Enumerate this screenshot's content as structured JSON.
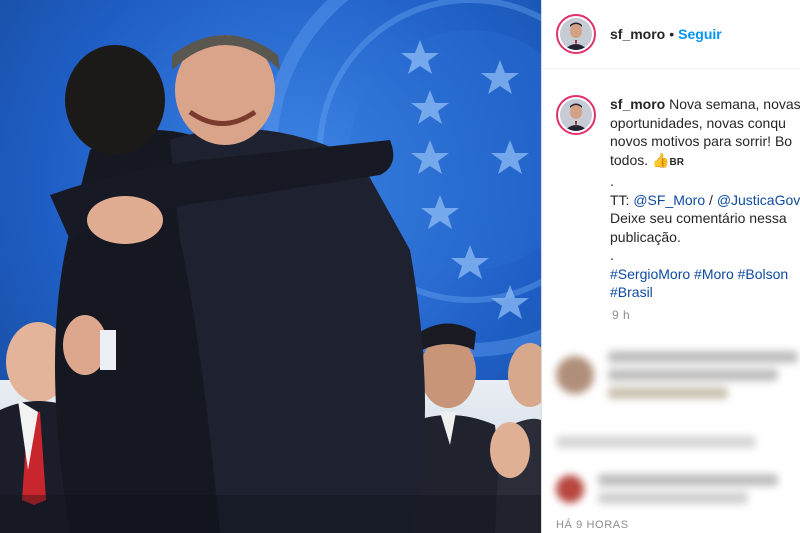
{
  "post": {
    "username": "sf_moro",
    "follow_label": "Seguir",
    "separator": "•"
  },
  "caption": {
    "username": "sf_moro",
    "lines": [
      "Nova semana, novas",
      "oportunidades, novas conqu",
      "novos motivos para sorrir! Bo",
      "todos."
    ],
    "flag_text": "BR",
    "dot1": ".",
    "tt_prefix": "TT:",
    "mention1": "@SF_Moro",
    "slash": "/",
    "mention2": "@JusticaGov",
    "line_comment1": "Deixe seu comentário nessa",
    "line_comment2": "publicação.",
    "dot2": ".",
    "hashtags_line1": "#SergioMoro #Moro #Bolson",
    "hashtags_line2": "#Brasil"
  },
  "time_ago": "9 h",
  "footer_time": "HÁ 9 HORAS",
  "colors": {
    "link": "#0095f6",
    "hashtag": "#0d4a9e",
    "photo_bg": "#1f5fc6",
    "ring": "#e1306c"
  },
  "icons": [
    "avatar",
    "thumbs-up-emoji"
  ]
}
